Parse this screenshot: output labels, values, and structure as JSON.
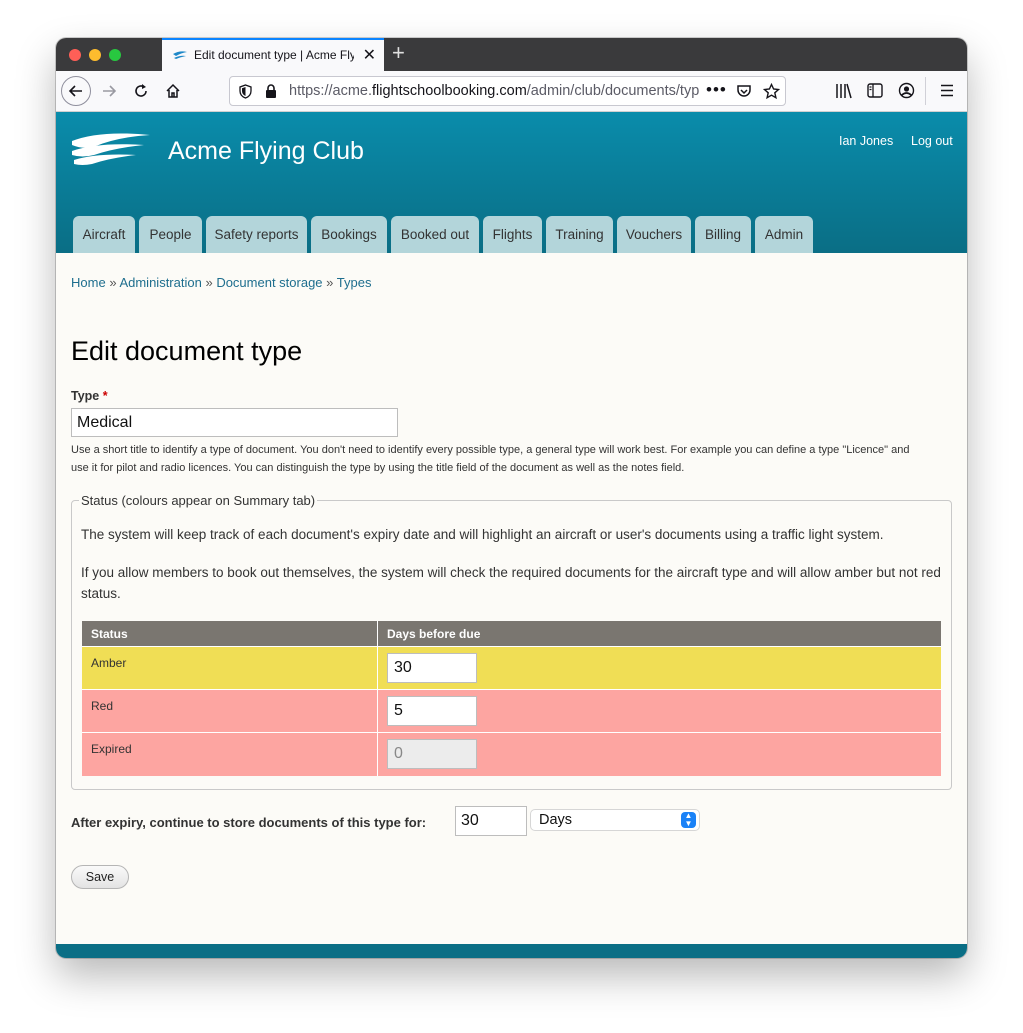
{
  "browser": {
    "tab_title": "Edit document type | Acme Flying Club",
    "url_prefix": "https://acme.",
    "url_domain": "flightschoolbooking.com",
    "url_path": "/admin/club/documents/types"
  },
  "site": {
    "name": "Acme Flying Club",
    "user_name": "Ian Jones",
    "logout_label": "Log out"
  },
  "nav": {
    "items": [
      "Aircraft",
      "People",
      "Safety reports",
      "Bookings",
      "Booked out",
      "Flights",
      "Training",
      "Vouchers",
      "Billing",
      "Admin"
    ]
  },
  "breadcrumb": {
    "items": [
      "Home",
      "Administration",
      "Document storage",
      "Types"
    ],
    "separator": "»"
  },
  "page": {
    "title": "Edit document type"
  },
  "form": {
    "type_label": "Type",
    "required_marker": "*",
    "type_value": "Medical",
    "type_description": "Use a short title to identify a type of document. You don't need to identify every possible type, a general type will work best. For example you can define a type \"Licence\" and use it for pilot and radio licences. You can distinguish the type by using the title field of the document as well as the notes field.",
    "status_legend": "Status (colours appear on Summary tab)",
    "status_p1": "The system will keep track of each document's expiry date and will highlight an aircraft or user's documents using a traffic light system.",
    "status_p2": "If you allow members to book out themselves, the system will check the required documents for the aircraft type and will allow amber but not red status.",
    "table": {
      "headers": [
        "Status",
        "Days before due"
      ],
      "rows": [
        {
          "status": "Amber",
          "days": "30",
          "color": "#f0de55"
        },
        {
          "status": "Red",
          "days": "5",
          "color": "#fda5a1"
        },
        {
          "status": "Expired",
          "days": "0",
          "color": "#fda5a1"
        }
      ]
    },
    "after_expiry_label": "After expiry, continue to store documents of this type for:",
    "after_expiry_value": "30",
    "after_expiry_unit": "Days",
    "save_label": "Save"
  },
  "colors": {
    "header": "#0a7e98",
    "tab": "#b3d5da",
    "link": "#1e6e8e"
  }
}
